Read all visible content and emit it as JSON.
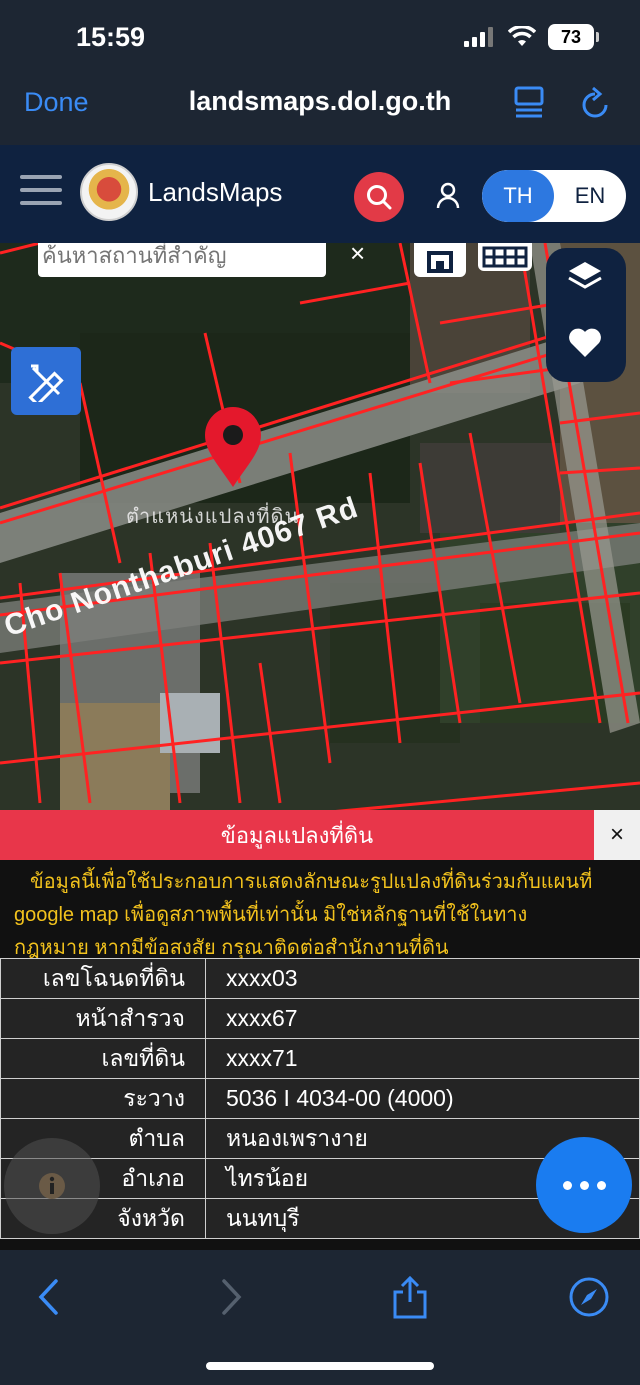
{
  "status": {
    "time": "15:59",
    "battery": "73"
  },
  "browser": {
    "done_label": "Done",
    "url": "landsmaps.dol.go.th"
  },
  "header": {
    "brand": "LandsMaps",
    "lang_th": "TH",
    "lang_en": "EN"
  },
  "map": {
    "search_placeholder": "ค้นหาสถานที่สำคัญ",
    "clear_label": "×",
    "pin_label": "ตำแหน่งแปลงที่ดิน",
    "road_label": "Cho Nonthaburi 4067 Rd"
  },
  "panel": {
    "title": "ข้อมูลแปลงที่ดิน",
    "close_label": "×",
    "disclaimer_line1": "ข้อมูลนี้เพื่อใช้ประกอบการแสดงลักษณะรูปแปลงที่ดินร่วมกับแผนที่",
    "disclaimer_line2": "google map เพื่อดูสภาพพื้นที่เท่านั้น มิใช่หลักฐานที่ใช้ในทาง",
    "disclaimer_line3": "กฎหมาย หากมีข้อสงสัย กรุณาติดต่อสำนักงานที่ดิน",
    "rows": [
      {
        "key": "เลขโฉนดที่ดิน",
        "value": "xxxx03"
      },
      {
        "key": "หน้าสำรวจ",
        "value": "xxxx67"
      },
      {
        "key": "เลขที่ดิน",
        "value": "xxxx71"
      },
      {
        "key": "ระวาง",
        "value": "5036 I 4034-00 (4000)"
      },
      {
        "key": "ตำบล",
        "value": "หนองเพรางาย"
      },
      {
        "key": "อำเภอ",
        "value": "ไทรน้อย"
      },
      {
        "key": "จังหวัด",
        "value": "นนทบุรี"
      }
    ]
  },
  "colors": {
    "header_bg": "#0f2240",
    "accent_blue": "#2d78e0",
    "accent_red": "#e8364a",
    "disclaimer_yellow": "#f2c21d"
  }
}
